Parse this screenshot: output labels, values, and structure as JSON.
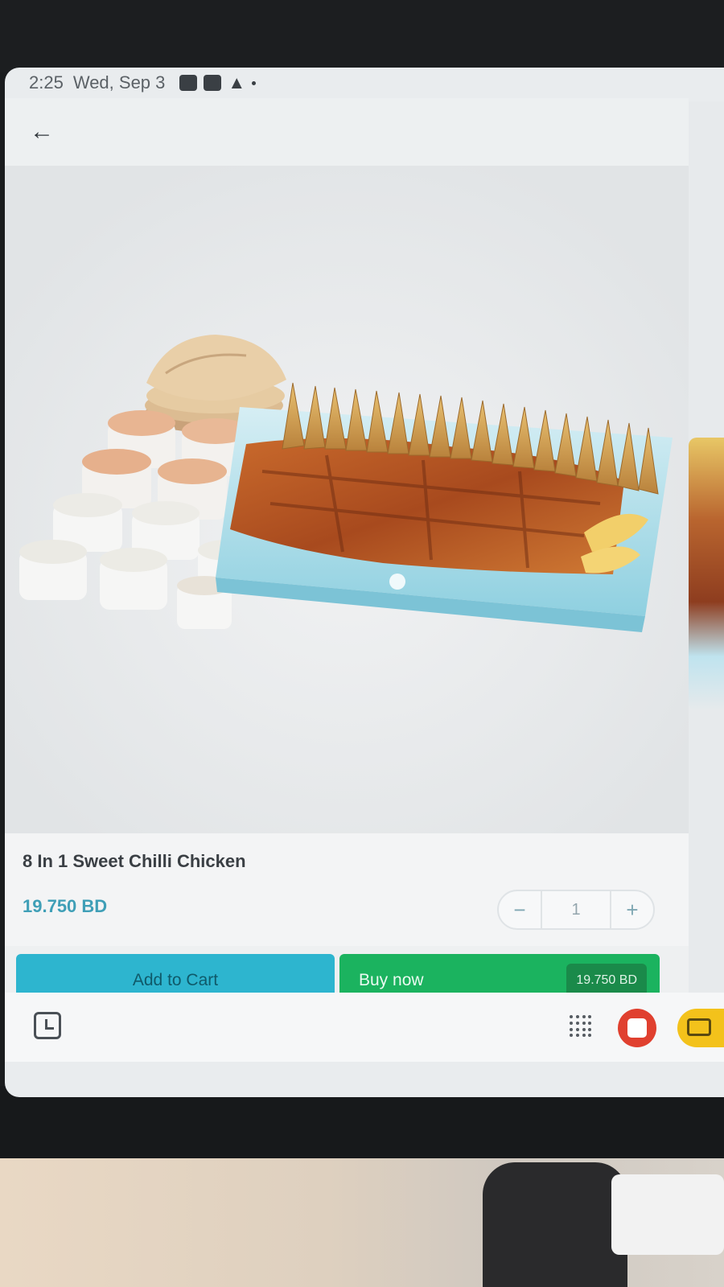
{
  "status_bar": {
    "time": "2:25",
    "date": "Wed, Sep 3",
    "icons": [
      "notification-icon",
      "mail-icon",
      "warning-icon",
      "dot-icon"
    ]
  },
  "header": {
    "back_icon": "arrow-left-icon",
    "back_glyph": "←"
  },
  "product": {
    "name": "8 In 1 Sweet Chilli Chicken",
    "price": "19.750 BD",
    "image": "platter-photo"
  },
  "quantity": {
    "minus_label": "−",
    "value": "1",
    "plus_label": "+"
  },
  "actions": {
    "add_to_cart_label": "Add to Cart",
    "buy_now_label": "Buy now",
    "buy_now_price": "19.750 BD"
  },
  "navigation": {
    "items": [
      "recent-apps-icon",
      "app-grid-icon",
      "red-app-icon",
      "yellow-app-icon"
    ]
  },
  "colors": {
    "price_accent": "#3f9fb7",
    "cart_button": "#2db5cf",
    "buy_button": "#1bb35f"
  }
}
